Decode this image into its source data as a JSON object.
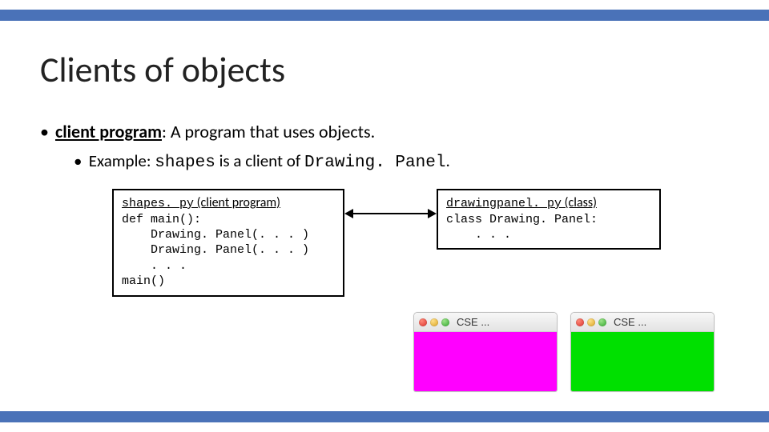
{
  "title": "Clients of objects",
  "bullet1": {
    "term": "client program",
    "def": ": A program that uses objects."
  },
  "bullet2": {
    "prefix": "Example: ",
    "code1": "shapes",
    "mid": " is a client of ",
    "code2": "Drawing. Panel",
    "suffix": "."
  },
  "left_box": {
    "filename": "shapes. py",
    "label": " (client program)",
    "code": "def main():\n    Drawing. Panel(. . . )\n    Drawing. Panel(. . . )\n    . . .\nmain()"
  },
  "right_box": {
    "filename": "drawingpanel. py",
    "label": " (class)",
    "code": "class Drawing. Panel:\n    . . ."
  },
  "windows": {
    "w1": {
      "title": "CSE ...",
      "color": "#ff00ff"
    },
    "w2": {
      "title": "CSE ...",
      "color": "#00e000"
    }
  }
}
